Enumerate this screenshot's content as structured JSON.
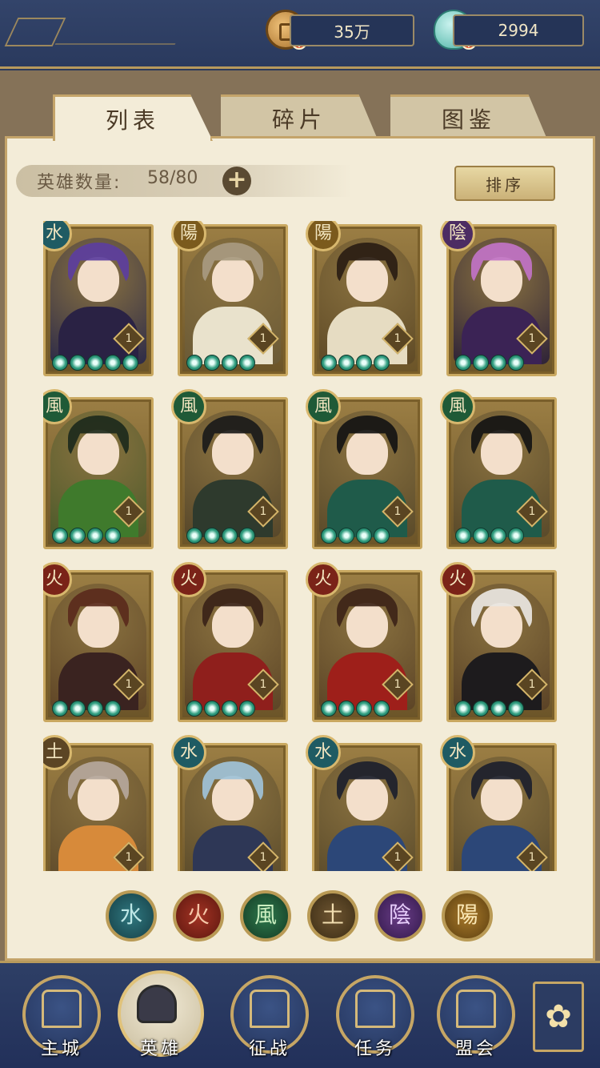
{
  "resources": {
    "coins": "35万",
    "gems": "2994"
  },
  "tabs": [
    {
      "label": "列表",
      "active": true
    },
    {
      "label": "碎片",
      "active": false
    },
    {
      "label": "图鉴",
      "active": false
    }
  ],
  "hero_count": {
    "label": "英雄数量:",
    "value": "58/80",
    "add_label": "+"
  },
  "sort_label": "排序",
  "elements": {
    "water": "水",
    "fire": "火",
    "wind": "風",
    "earth": "土",
    "yin": "陰",
    "yang": "陽"
  },
  "heroes": [
    {
      "element": "water",
      "elem_label": "水",
      "level": "1",
      "stars": 5,
      "hair": "#5c3e9e",
      "body": "#2a2244",
      "bg": "#2c2a48"
    },
    {
      "element": "yang",
      "elem_label": "陽",
      "level": "1",
      "stars": 4,
      "hair": "#a89a80",
      "body": "#e9e2cc",
      "bg": "#6b5a36"
    },
    {
      "element": "yang",
      "elem_label": "陽",
      "level": "1",
      "stars": 4,
      "hair": "#2a1d14",
      "body": "#e6dcc2",
      "bg": "#5f4a26"
    },
    {
      "element": "yin",
      "elem_label": "陰",
      "level": "1",
      "stars": 4,
      "hair": "#c173c6",
      "body": "#3b2355",
      "bg": "#2d2238"
    },
    {
      "element": "wind",
      "elem_label": "風",
      "level": "1",
      "stars": 4,
      "hair": "#1d2a1c",
      "body": "#3f7a2c",
      "bg": "#4c5a2a"
    },
    {
      "element": "wind",
      "elem_label": "風",
      "level": "1",
      "stars": 4,
      "hair": "#1a1a1a",
      "body": "#2e3a2d",
      "bg": "#57472a"
    },
    {
      "element": "wind",
      "elem_label": "風",
      "level": "1",
      "stars": 4,
      "hair": "#141414",
      "body": "#1f5b4a",
      "bg": "#5a4a2a"
    },
    {
      "element": "wind",
      "elem_label": "風",
      "level": "1",
      "stars": 4,
      "hair": "#141414",
      "body": "#1f5b4a",
      "bg": "#5a4a2a"
    },
    {
      "element": "fire",
      "elem_label": "火",
      "level": "1",
      "stars": 4,
      "hair": "#5a2a1c",
      "body": "#3a2320",
      "bg": "#5f4526"
    },
    {
      "element": "fire",
      "elem_label": "火",
      "level": "1",
      "stars": 4,
      "hair": "#3a2318",
      "body": "#8f1f1c",
      "bg": "#5c4426"
    },
    {
      "element": "fire",
      "elem_label": "火",
      "level": "1",
      "stars": 4,
      "hair": "#3d2418",
      "body": "#9e1f1a",
      "bg": "#5c4426"
    },
    {
      "element": "fire",
      "elem_label": "火",
      "level": "1",
      "stars": 4,
      "hair": "#e9e6e2",
      "body": "#1d1b1d",
      "bg": "#5a4226"
    },
    {
      "element": "earth",
      "elem_label": "土",
      "level": "1",
      "stars": 0,
      "hair": "#b5a79c",
      "body": "#d78a3a",
      "bg": "#5f4a2a"
    },
    {
      "element": "water",
      "elem_label": "水",
      "level": "1",
      "stars": 0,
      "hair": "#9fc2d8",
      "body": "#2e3756",
      "bg": "#5a4a2a"
    },
    {
      "element": "water",
      "elem_label": "水",
      "level": "1",
      "stars": 0,
      "hair": "#1c1f2c",
      "body": "#2c4778",
      "bg": "#5a4a2a"
    },
    {
      "element": "water",
      "elem_label": "水",
      "level": "1",
      "stars": 0,
      "hair": "#1c1f2c",
      "body": "#2c4778",
      "bg": "#5a4a2a"
    }
  ],
  "filters": [
    {
      "key": "water",
      "label": "水"
    },
    {
      "key": "fire",
      "label": "火"
    },
    {
      "key": "wind",
      "label": "風"
    },
    {
      "key": "earth",
      "label": "土"
    },
    {
      "key": "yin",
      "label": "陰"
    },
    {
      "key": "yang",
      "label": "陽"
    }
  ],
  "nav": [
    {
      "key": "city",
      "label": "主城",
      "active": false
    },
    {
      "key": "heroes",
      "label": "英雄",
      "active": true
    },
    {
      "key": "battle",
      "label": "征战",
      "active": false
    },
    {
      "key": "quests",
      "label": "任务",
      "active": false
    },
    {
      "key": "guild",
      "label": "盟会",
      "active": false
    }
  ],
  "menu_icon": "menu-icon"
}
